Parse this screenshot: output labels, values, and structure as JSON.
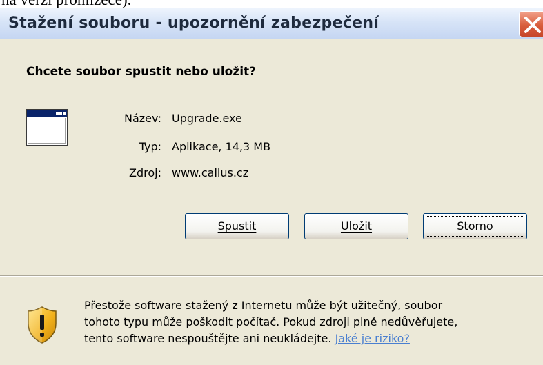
{
  "page_top_text": "na verzi prohlížeče).",
  "window": {
    "title": "Stažení souboru - upozornění zabezpečení"
  },
  "dialog": {
    "question": "Chcete soubor spustit nebo uložit?",
    "fields": [
      {
        "label": "Název:",
        "value": "Upgrade.exe"
      },
      {
        "label": "Typ:",
        "value": "Aplikace, 14,3 MB"
      },
      {
        "label": "Zdroj:",
        "value": "www.callus.cz"
      }
    ],
    "buttons": {
      "run": "Spustit",
      "save": "Uložit",
      "cancel": "Storno"
    }
  },
  "warning": {
    "line1": "Přestože software stažený z Internetu může být užitečný, soubor",
    "line2": "tohoto typu může poškodit počítač. Pokud zdroji plně nedůvěřujete,",
    "line3": "tento software nespouštějte ani neukládejte.",
    "link": "Jaké je riziko?"
  },
  "colors": {
    "dialog_background": "#ece9d8",
    "link": "#4a7fd0",
    "close_button": "#d85d3c"
  },
  "icons": [
    "application-window-icon",
    "security-shield-warning-icon",
    "close-icon"
  ]
}
